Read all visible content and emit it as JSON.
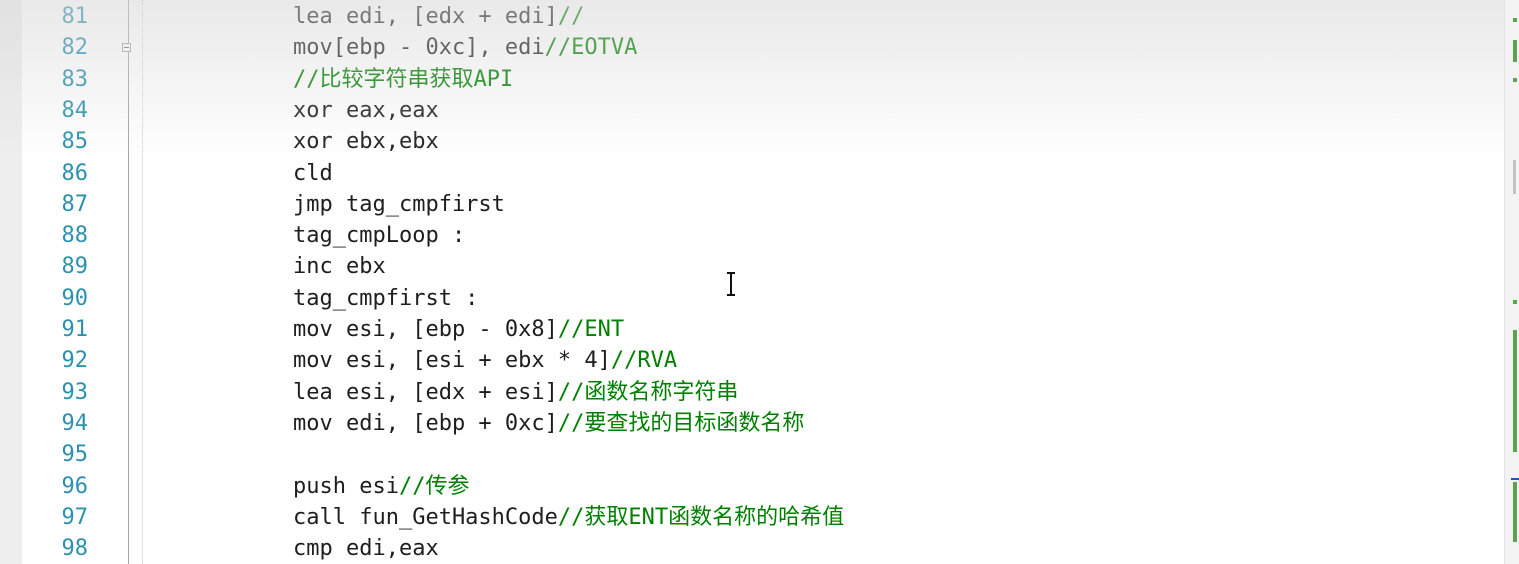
{
  "editor": {
    "lines": [
      {
        "number": "81",
        "code": "lea edi, [edx + edi]",
        "comment": "//"
      },
      {
        "number": "82",
        "code": "mov[ebp - 0xc], edi",
        "comment": "//EOTVA"
      },
      {
        "number": "83",
        "code": "",
        "comment": "//比较字符串获取API"
      },
      {
        "number": "84",
        "code": "xor eax,eax",
        "comment": ""
      },
      {
        "number": "85",
        "code": "xor ebx,ebx",
        "comment": ""
      },
      {
        "number": "86",
        "code": "cld",
        "comment": ""
      },
      {
        "number": "87",
        "code": "jmp tag_cmpfirst",
        "comment": ""
      },
      {
        "number": "88",
        "code": "tag_cmpLoop :",
        "comment": ""
      },
      {
        "number": "89",
        "code": "inc ebx",
        "comment": ""
      },
      {
        "number": "90",
        "code": "tag_cmpfirst :",
        "comment": ""
      },
      {
        "number": "91",
        "code": "mov esi, [ebp - 0x8]",
        "comment": "//ENT"
      },
      {
        "number": "92",
        "code": "mov esi, [esi + ebx * 4]",
        "comment": "//RVA"
      },
      {
        "number": "93",
        "code": "lea esi, [edx + esi]",
        "comment": "//函数名称字符串"
      },
      {
        "number": "94",
        "code": "mov edi, [ebp + 0xc]",
        "comment": "//要查找的目标函数名称"
      },
      {
        "number": "95",
        "code": "",
        "comment": ""
      },
      {
        "number": "96",
        "code": "push esi",
        "comment": "//传参"
      },
      {
        "number": "97",
        "code": "call fun_GetHashCode",
        "comment": "//获取ENT函数名称的哈希值"
      },
      {
        "number": "98",
        "code": "cmp edi,eax",
        "comment": ""
      }
    ]
  },
  "colors": {
    "line_number": "#2b91af",
    "code_text": "#1e1e1e",
    "comment": "#008000",
    "change_marker": "#57a64a",
    "caret_marker": "#1f4fd6"
  },
  "icons": {
    "fold_toggle": "collapse-minus-icon",
    "cursor": "text-ibeam-cursor"
  }
}
